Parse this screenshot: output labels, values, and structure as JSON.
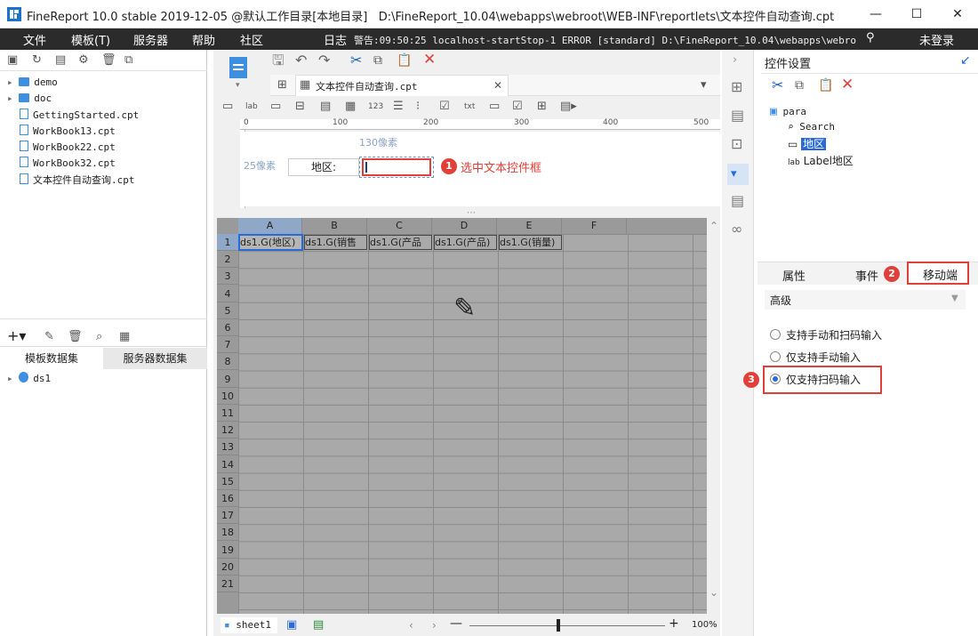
{
  "window": {
    "title": "FineReport 10.0 stable 2019-12-05 @默认工作目录[本地目录]",
    "path": "D:\\FineReport_10.04\\webapps\\webroot\\WEB-INF\\reportlets\\文本控件自动查询.cpt"
  },
  "menu": {
    "file": "文件",
    "template": "模板(T)",
    "server": "服务器",
    "help": "帮助",
    "community": "社区",
    "log": "日志",
    "alarm": "警告:09:50:25 localhost-startStop-1 ERROR [standard] D:\\FineReport_10.04\\webapps\\webroot\\W...",
    "login": "未登录"
  },
  "tree": {
    "items": [
      {
        "label": "demo",
        "type": "folder"
      },
      {
        "label": "doc",
        "type": "folder"
      },
      {
        "label": "GettingStarted.cpt",
        "type": "file"
      },
      {
        "label": "WorkBook13.cpt",
        "type": "file"
      },
      {
        "label": "WorkBook22.cpt",
        "type": "file"
      },
      {
        "label": "WorkBook32.cpt",
        "type": "file"
      },
      {
        "label": "文本控件自动查询.cpt",
        "type": "file"
      }
    ]
  },
  "datasets": {
    "tab_template": "模板数据集",
    "tab_server": "服务器数据集",
    "items": [
      "ds1"
    ]
  },
  "editor": {
    "tab_label": "文本控件自动查询.cpt",
    "ruler_marks": [
      "0",
      "100",
      "200",
      "300",
      "400",
      "500"
    ],
    "param": {
      "width_label": "130像素",
      "height_label": "25像素",
      "field_label": "地区:"
    },
    "annotation1": "选中文本控件框",
    "columns": [
      "A",
      "B",
      "C",
      "D",
      "E",
      "F"
    ],
    "rows": [
      "1",
      "2",
      "3",
      "4",
      "5",
      "6",
      "7",
      "8",
      "9",
      "10",
      "11",
      "12",
      "13",
      "14",
      "15",
      "16",
      "17",
      "18",
      "19",
      "20",
      "21"
    ],
    "row1_cells": [
      "ds1.G(地区)",
      "ds1.G(销售",
      "ds1.G(产品",
      "ds1.G(产品)",
      "ds1.G(销量)"
    ],
    "sheet": "sheet1",
    "zoom": "100%"
  },
  "rightpanel": {
    "title": "控件设置",
    "widgets": {
      "root": "para",
      "children": [
        "Search",
        "地区",
        "Label地区"
      ]
    },
    "tabs": {
      "props": "属性",
      "events": "事件",
      "mobile": "移动端"
    },
    "advanced": "高级",
    "options": [
      "支持手动和扫码输入",
      "仅支持手动输入",
      "仅支持扫码输入"
    ],
    "selected_option": 2
  },
  "badges": [
    "1",
    "2",
    "3"
  ],
  "colors": {
    "accent": "#e0403a",
    "select": "#2a6ad8",
    "menubar": "#2b2b2b"
  }
}
